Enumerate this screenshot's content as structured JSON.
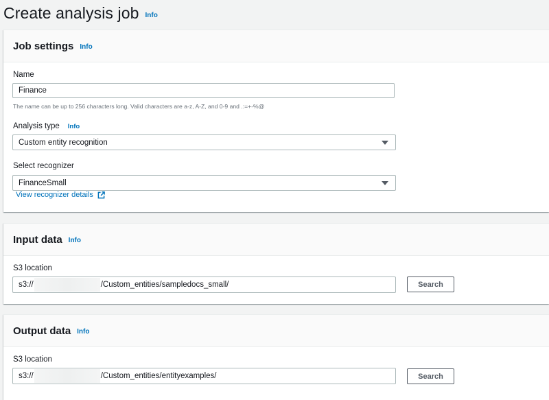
{
  "page": {
    "title": "Create analysis job",
    "info": "Info"
  },
  "job_settings": {
    "title": "Job settings",
    "info": "Info",
    "name": {
      "label": "Name",
      "value": "Finance",
      "hint": "The name can be up to 256 characters long. Valid characters are a-z, A-Z, and 0-9 and .:=+-%@"
    },
    "analysis_type": {
      "label": "Analysis type",
      "info": "Info",
      "value": "Custom entity recognition"
    },
    "recognizer": {
      "label": "Select recognizer",
      "value": "FinanceSmall",
      "details_link": "View recognizer details"
    }
  },
  "input_data": {
    "title": "Input data",
    "info": "Info",
    "s3": {
      "label": "S3 location",
      "prefix": "s3://",
      "suffix": "/Custom_entities/sampledocs_small/",
      "search": "Search"
    }
  },
  "output_data": {
    "title": "Output data",
    "info": "Info",
    "s3": {
      "label": "S3 location",
      "prefix": "s3://",
      "suffix": "/Custom_entities/entityexamples/",
      "search": "Search"
    }
  },
  "icons": {
    "dropdown": "caret-down-icon",
    "external": "external-link-icon"
  },
  "colors": {
    "link": "#0073bb",
    "background": "#f2f3f3",
    "panel_header": "#fafafa",
    "border": "#aab7b8",
    "button_text": "#545b64"
  }
}
